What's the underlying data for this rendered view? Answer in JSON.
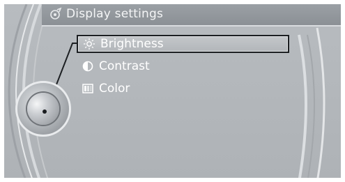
{
  "header": {
    "title": "Display settings",
    "icon": "display-settings-icon"
  },
  "menu": {
    "items": [
      {
        "label": "Brightness",
        "icon": "sun-icon",
        "selected": true
      },
      {
        "label": "Contrast",
        "icon": "contrast-icon",
        "selected": false
      },
      {
        "label": "Color",
        "icon": "color-icon",
        "selected": false
      }
    ]
  },
  "colors": {
    "background": "#b3b7bb",
    "text": "#ffffff",
    "selection_border": "#1c1f22"
  }
}
